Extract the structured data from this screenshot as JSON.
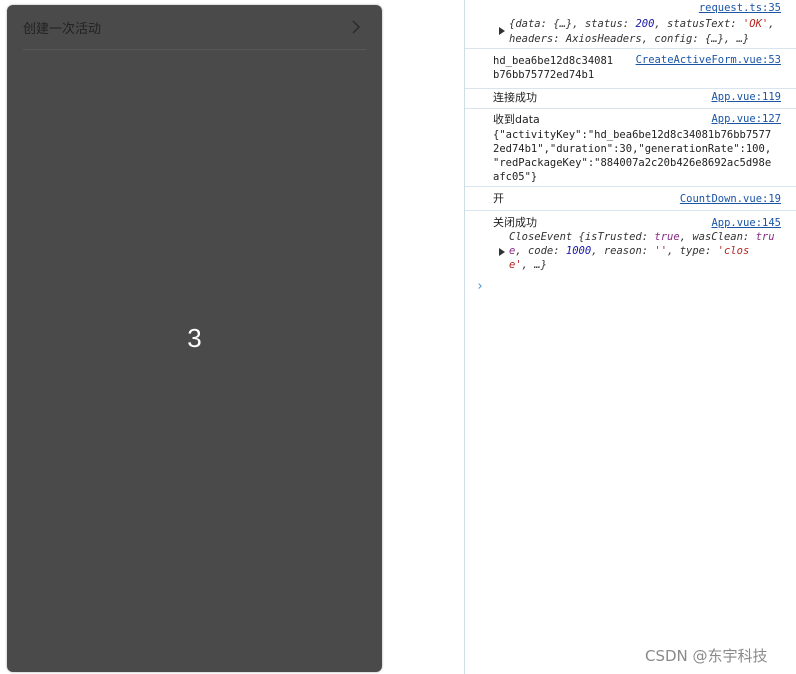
{
  "app": {
    "nav_title": "创建一次活动",
    "countdown": "3"
  },
  "console": {
    "entries": [
      {
        "source": "request.ts:35",
        "lines": [
          "{data: {…}, status: 200, statusText: 'OK',",
          "headers: AxiosHeaders, config: {…}, …}"
        ]
      },
      {
        "source": "CreateActiveForm.vue:53",
        "lines": [
          "hd_bea6be12d8c34081",
          "b76bb75772ed74b1"
        ]
      },
      {
        "source": "App.vue:119",
        "lines": [
          "连接成功"
        ]
      },
      {
        "source": "App.vue:127",
        "lines": [
          "收到data",
          "{\"activityKey\":\"hd_bea6be12d8c34081b76bb7577",
          "2ed74b1\",\"duration\":30,\"generationRate\":100,",
          "\"redPackageKey\":\"884007a2c20b426e8692ac5d98e",
          "afc05\"}"
        ]
      },
      {
        "source": "CountDown.vue:19",
        "lines": [
          "开"
        ]
      },
      {
        "source": "App.vue:145",
        "lines": [
          "关闭成功",
          "CloseEvent {isTrusted: true, wasClean: tru",
          "e, code: 1000, reason: '', type: 'clos",
          "e', …}"
        ]
      }
    ]
  },
  "watermark": "CSDN @东宇科技",
  "colors": {
    "phone_bg": "#4a4a4a",
    "link": "#1a55a6",
    "prompt": "#4a8fd8"
  }
}
